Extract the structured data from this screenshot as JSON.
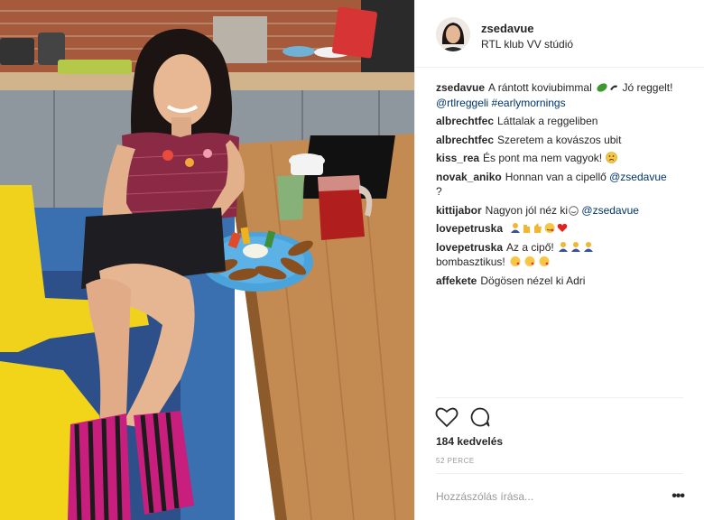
{
  "post": {
    "username": "zsedavue",
    "location": "RTL klub VV stúdió",
    "caption": {
      "user": "zsedavue",
      "text": "A rántott koviubimmal",
      "text2": "Jó reggelt!",
      "mention": "@rtlreggeli",
      "hashtag": "#earlymornings"
    },
    "comments": [
      {
        "user": "albrechtfec",
        "text": "Láttalak a reggeliben"
      },
      {
        "user": "albrechtfec",
        "text": "Szeretem a kovászos ubit"
      },
      {
        "user": "kiss_rea",
        "text": "És pont ma nem vagyok!"
      },
      {
        "user": "novak_aniko",
        "text": "Honnan van a cipellő",
        "mention": "@zsedavue",
        "suffix": "?"
      },
      {
        "user": "kittijabor",
        "text": "Nagyon jól néz ki",
        "mention": "@zsedavue"
      },
      {
        "user": "lovepetruska",
        "text": ""
      },
      {
        "user": "lovepetruska",
        "text": "Az a cipő!",
        "text2": "bombasztikus!"
      },
      {
        "user": "affekete",
        "text": "Dögösen nézel ki Adri"
      }
    ],
    "likes": "184 kedvelés",
    "time": "52 PERCE",
    "add_comment_placeholder": "Hozzászólás írása...",
    "more_label": "•••"
  },
  "icons": {
    "like": "heart-outline-icon",
    "comment": "comment-bubble-icon",
    "more": "ellipsis-icon"
  },
  "colors": {
    "link": "#003569",
    "text": "#262626",
    "muted": "#999999"
  }
}
